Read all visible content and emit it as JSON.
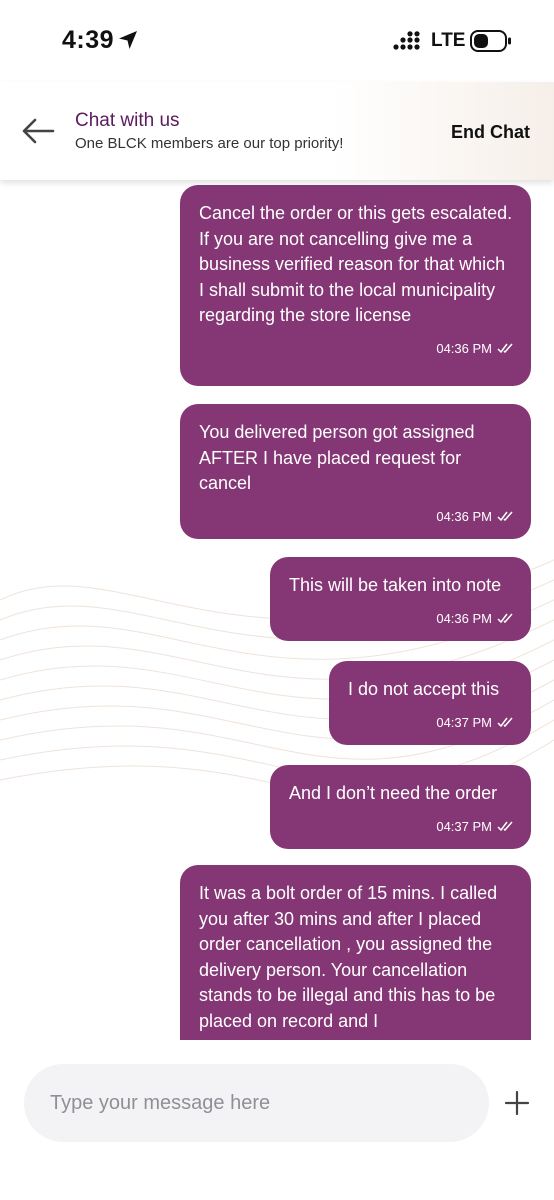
{
  "status_bar": {
    "time": "4:39",
    "network": "LTE"
  },
  "header": {
    "title": "Chat with us",
    "subtitle": "One BLCK members are our top priority!",
    "end_chat": "End Chat"
  },
  "messages": [
    {
      "text": "Cancel the order or this gets escalated. If you are not cancelling give me a business verified reason for that which I shall submit to the local municipality regarding the store license",
      "time": "04:36 PM"
    },
    {
      "text": "You delivered person got assigned AFTER I have placed request for cancel",
      "time": "04:36 PM"
    },
    {
      "text": "This will be taken into note",
      "time": "04:36 PM"
    },
    {
      "text": "I do not accept this",
      "time": "04:37 PM"
    },
    {
      "text": "And I don’t need the order",
      "time": "04:37 PM"
    },
    {
      "text": "It was a bolt order of 15 mins. I called you after 30 mins and after I placed order cancellation , you assigned the delivery person. Your cancellation stands to be illegal and this has to be placed on record and I",
      "time": ""
    }
  ],
  "composer": {
    "placeholder": "Type your message here"
  },
  "colors": {
    "bubble": "#853775",
    "header_title": "#5b1b5e"
  }
}
